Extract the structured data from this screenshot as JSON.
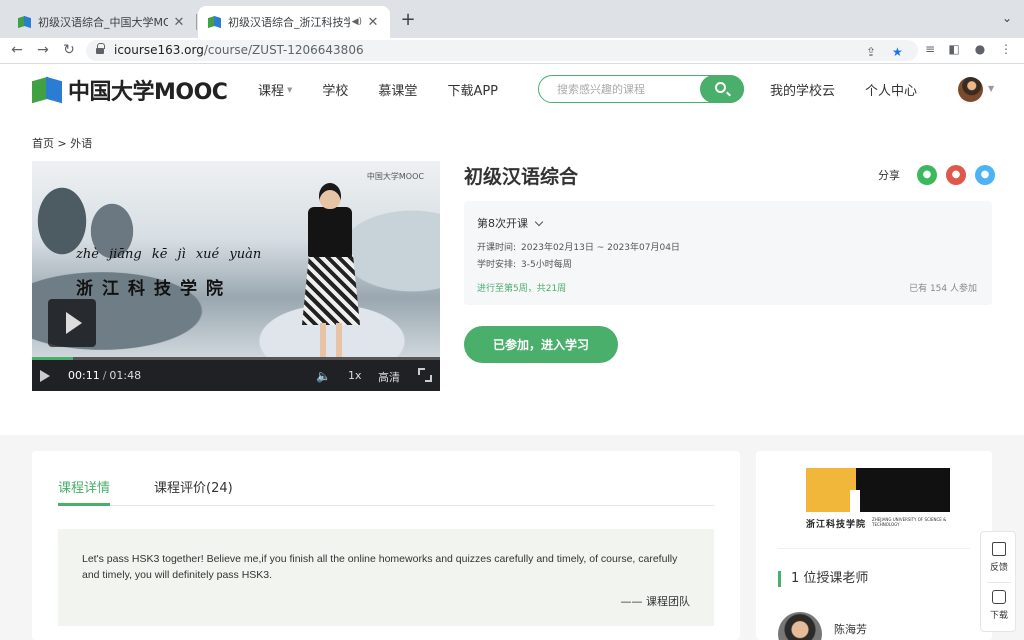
{
  "browser": {
    "tabs": [
      {
        "title": "初级汉语综合_中国大学MOOC(慕课)",
        "active": false
      },
      {
        "title": "初级汉语综合_浙江科技学院_中国大学MOOC",
        "active": true
      }
    ],
    "url_host": "icourse163.org",
    "url_path": "/course/ZUST-1206643806"
  },
  "site": {
    "logo_text": "中国大学MOOC",
    "nav": [
      {
        "label": "课程",
        "has_dropdown": true
      },
      {
        "label": "学校"
      },
      {
        "label": "慕课堂"
      },
      {
        "label": "下载APP"
      }
    ],
    "search_placeholder": "搜索感兴趣的课程",
    "user_nav": [
      {
        "label": "我的学校云"
      },
      {
        "label": "个人中心"
      }
    ]
  },
  "breadcrumb": {
    "home": "首页",
    "sep": ">",
    "current": "外语"
  },
  "video": {
    "watermark": "中国大学MOOC",
    "pinyin": "zhè jiāng kē jì xué yuàn",
    "hanzi": "浙江科技学院",
    "current_time": "00:11",
    "time_sep": "/",
    "duration": "01:48",
    "progress_fraction": 0.1,
    "speed": "1x",
    "quality": "高清"
  },
  "course": {
    "title": "初级汉语综合",
    "share_label": "分享",
    "term": "第8次开课",
    "schedule_label": "开课时间:",
    "schedule_value": "2023年02月13日 ~ 2023年07月04日",
    "hours_label": "学时安排:",
    "hours_value": "3-5小时每周",
    "status": "进行至第5周，共21周",
    "enrolled": "已有 154 人参加",
    "join_button": "已参加，进入学习"
  },
  "detail": {
    "tab_details": "课程详情",
    "tab_reviews": "课程评价(24)",
    "quote": "Let's pass HSK3 together! Believe me,if you finish all the online homeworks and quizzes carefully and timely, of course, carefully and timely, you will definitely pass HSK3.",
    "quote_by": "—— 课程团队"
  },
  "school": {
    "name_cn": "浙江科技学院",
    "name_en": "ZHEJIANG UNIVERSITY OF SCIENCE & TECHNOLOGY",
    "teachers_title": "1 位授课老师",
    "teacher_name": "陈海芳"
  },
  "float_tools": {
    "feedback": "反馈",
    "download": "下载"
  },
  "colors": {
    "brand_green": "#49af6a",
    "logo_blue": "#2b7cd3",
    "school_gold": "#f0b73a"
  }
}
